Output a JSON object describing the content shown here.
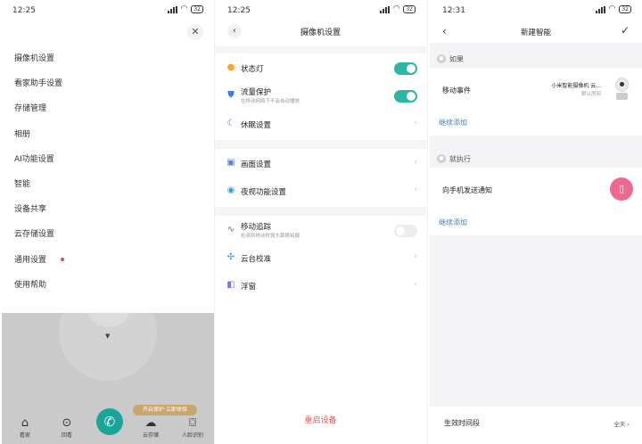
{
  "panel1": {
    "status_time": "12:25",
    "battery": "32",
    "close_icon": "close-icon",
    "menu": [
      {
        "label": "摄像机设置"
      },
      {
        "label": "看家助手设置"
      },
      {
        "label": "存储管理"
      },
      {
        "label": "相册"
      },
      {
        "label": "AI功能设置"
      },
      {
        "label": "智能"
      },
      {
        "label": "设备共享"
      },
      {
        "label": "云存储设置"
      },
      {
        "label": "通用设置",
        "badge": true
      },
      {
        "label": "使用帮助"
      }
    ],
    "camera_tip": "开启保护·立即体验",
    "bottom_nav": [
      {
        "label": "看家",
        "icon": "home-icon"
      },
      {
        "label": "回看",
        "icon": "play-icon"
      },
      {
        "label": "云存储",
        "icon": "cloud-icon"
      },
      {
        "label": "人脸识别",
        "icon": "face-scan-icon"
      }
    ],
    "call_icon": "phone-call-icon"
  },
  "panel2": {
    "status_time": "12:25",
    "battery": "32",
    "title": "摄像机设置",
    "rows": [
      {
        "label": "状态灯",
        "icon": "light-bulb-icon",
        "icon_color": "#f5a623",
        "toggle": true
      },
      {
        "label": "流量保护",
        "desc": "在移动网络下不会自动播放",
        "icon": "shield-icon",
        "icon_color": "#3b7de0",
        "toggle": true
      },
      {
        "label": "休眠设置",
        "icon": "moon-icon",
        "icon_color": "#3b7de0"
      },
      {
        "label": "画面设置",
        "icon": "picture-icon",
        "icon_color": "#5b7fd9"
      },
      {
        "label": "夜视功能设置",
        "icon": "eye-icon",
        "icon_color": "#3a9bd6"
      },
      {
        "label": "移动追踪",
        "desc": "检测到移动时镜头跟随拍摄",
        "icon": "motion-track-icon",
        "icon_color": "#6a5fd6",
        "toggle": false
      },
      {
        "label": "云台校准",
        "icon": "calibrate-icon",
        "icon_color": "#2a9bd8"
      },
      {
        "label": "浮窗",
        "icon": "float-window-icon",
        "icon_color": "#8a6fe0"
      }
    ],
    "reset_label": "重启设备"
  },
  "panel3": {
    "status_time": "12:31",
    "battery": "32",
    "title": "新建智能",
    "if_label": "如果",
    "trigger_label": "移动事件",
    "device_name": "小米智能摄像机 云...",
    "device_room": "默认房间",
    "add_more_if": "继续添加",
    "then_label": "就执行",
    "action_label": "向手机发送通知",
    "add_more_then": "继续添加",
    "effective_label": "生效时间段",
    "effective_value": "全天"
  },
  "colors": {
    "accent_teal": "#2ab7a3",
    "danger_red": "#e25b5b",
    "link_blue": "#3d7fd1",
    "notify_pink": "#ee6a8d"
  }
}
